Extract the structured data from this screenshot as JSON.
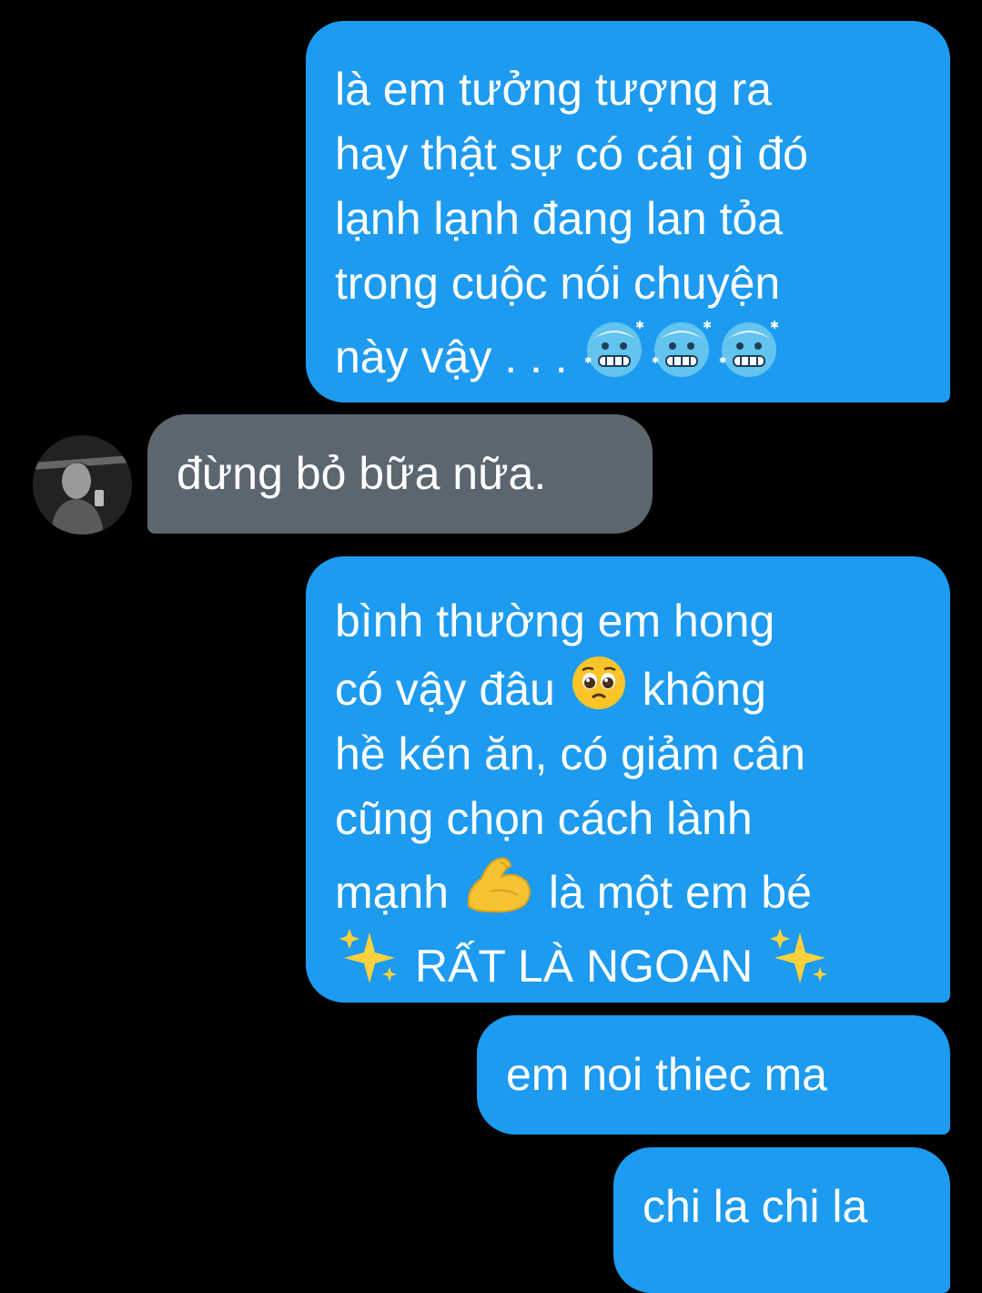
{
  "conversation": {
    "messages": [
      {
        "sender": "me",
        "lines": [
          "là em tưởng tượng ra",
          "hay thật sự có cái gì đó",
          "lạnh lạnh đang lan tỏa",
          "trong cuộc nói chuyện",
          "này vậy . . ."
        ],
        "emoji": [
          "cold-face-emoji",
          "cold-face-emoji",
          "cold-face-emoji"
        ]
      },
      {
        "sender": "other",
        "text": "đừng bỏ bữa nữa."
      },
      {
        "sender": "me",
        "line1": "bình thường em hong",
        "line2a": "có vậy đâu",
        "line2b": "không",
        "line3": "hề kén ăn, có giảm cân",
        "line4": "cũng chọn cách lành",
        "line5a": "mạnh",
        "line5b": "là một em bé",
        "line6": "RẤT LÀ NGOAN",
        "emoji": [
          "pleading-face-emoji",
          "flexed-biceps-emoji",
          "sparkles-emoji"
        ]
      },
      {
        "sender": "me",
        "text": "em noi thiec ma"
      },
      {
        "sender": "me",
        "text": "chi la chi la"
      }
    ]
  },
  "colors": {
    "background": "#000000",
    "sent_bubble": "#1d9bf0",
    "received_bubble": "#5b6670",
    "text": "#ffffff"
  }
}
